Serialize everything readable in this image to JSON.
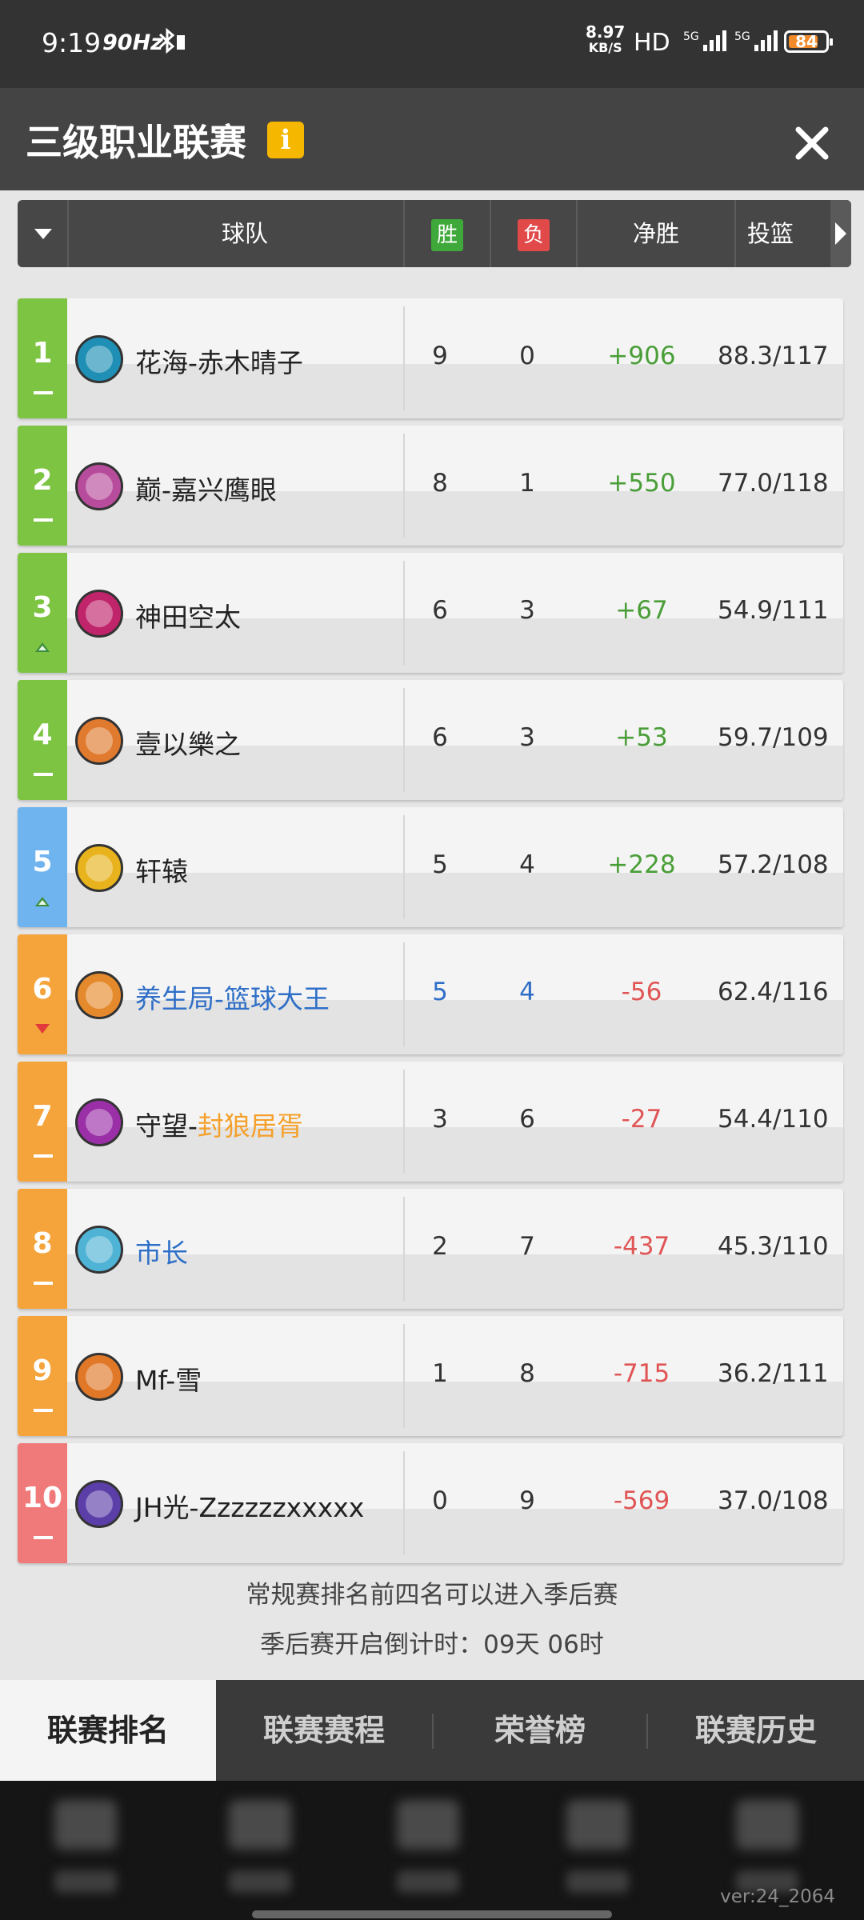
{
  "status_bar": {
    "time": "9:19",
    "refresh_rate": "90Hz",
    "net_speed_value": "8.97",
    "net_speed_unit": "KB/S",
    "hd_label": "HD",
    "signal1": "5G",
    "signal2": "5G",
    "battery": "84"
  },
  "header": {
    "title": "三级职业联赛",
    "info_label": "i"
  },
  "table": {
    "columns": {
      "team": "球队",
      "wins": "胜",
      "losses": "负",
      "diff": "净胜",
      "shooting": "投篮"
    },
    "rows": [
      {
        "rank": "1",
        "trend": "same",
        "team": "花海-赤木晴子",
        "wins": "9",
        "losses": "0",
        "diff": "+906",
        "shooting": "88.3/117",
        "rank_color": "#7dc443",
        "avatar_color": "#1f8fb5"
      },
      {
        "rank": "2",
        "trend": "same",
        "team": "巅-嘉兴鹰眼",
        "wins": "8",
        "losses": "1",
        "diff": "+550",
        "shooting": "77.0/118",
        "rank_color": "#7dc443",
        "avatar_color": "#b84c9c"
      },
      {
        "rank": "3",
        "trend": "up",
        "team": "神田空太",
        "wins": "6",
        "losses": "3",
        "diff": "+67",
        "shooting": "54.9/111",
        "rank_color": "#7dc443",
        "avatar_color": "#c0246a"
      },
      {
        "rank": "4",
        "trend": "same",
        "team": "壹以樂之",
        "wins": "6",
        "losses": "3",
        "diff": "+53",
        "shooting": "59.7/109",
        "rank_color": "#7dc443",
        "avatar_color": "#e07a2e"
      },
      {
        "rank": "5",
        "trend": "up",
        "team": "轩辕",
        "wins": "5",
        "losses": "4",
        "diff": "+228",
        "shooting": "57.2/108",
        "rank_color": "#6fb3ef",
        "avatar_color": "#e8b31c"
      },
      {
        "rank": "6",
        "trend": "down",
        "team": "养生局-篮球大王",
        "wins": "5",
        "losses": "4",
        "diff": "-56",
        "shooting": "62.4/116",
        "rank_color": "#f5a33b",
        "avatar_color": "#e58a2c",
        "highlight": true
      },
      {
        "rank": "7",
        "trend": "same",
        "team_prefix": "守望-",
        "team_suffix": "封狼居胥",
        "team": "守望-封狼居胥",
        "wins": "3",
        "losses": "6",
        "diff": "-27",
        "shooting": "54.4/110",
        "rank_color": "#f5a33b",
        "avatar_color": "#9a2fa8"
      },
      {
        "rank": "8",
        "trend": "same",
        "team": "市长",
        "wins": "2",
        "losses": "7",
        "diff": "-437",
        "shooting": "45.3/110",
        "rank_color": "#f5a33b",
        "avatar_color": "#4fb3d6",
        "blue_name": true
      },
      {
        "rank": "9",
        "trend": "same",
        "team": "Mf-雪",
        "wins": "1",
        "losses": "8",
        "diff": "-715",
        "shooting": "36.2/111",
        "rank_color": "#f5a33b",
        "avatar_color": "#e07828"
      },
      {
        "rank": "10",
        "trend": "same",
        "team": "JH光-Zzzzzzxxxxx",
        "wins": "0",
        "losses": "9",
        "diff": "-569",
        "shooting": "37.0/108",
        "rank_color": "#f07a7a",
        "avatar_color": "#5b3ea8"
      }
    ]
  },
  "notes": {
    "playoff_rule": "常规赛排名前四名可以进入季后赛",
    "countdown": "季后赛开启倒计时：09天 06时"
  },
  "tabs": [
    {
      "label": "联赛排名",
      "active": true
    },
    {
      "label": "联赛赛程",
      "active": false
    },
    {
      "label": "荣誉榜",
      "active": false
    },
    {
      "label": "联赛历史",
      "active": false
    }
  ],
  "version": "ver:24_2064",
  "colors": {
    "positive": "#4a9e38",
    "negative": "#e05555",
    "win_badge": "#3fa83a",
    "loss_badge": "#e24a4a",
    "info_badge": "#f5b700",
    "name_blue": "#2f6fc7",
    "name_orange": "#f5a02a"
  }
}
